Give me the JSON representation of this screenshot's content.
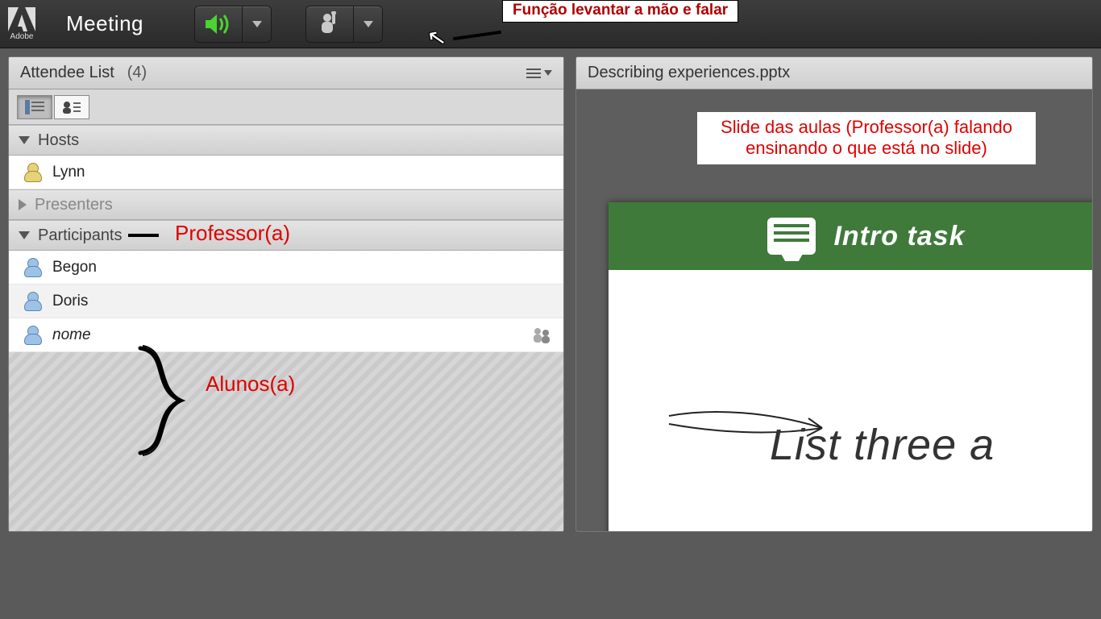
{
  "topbar": {
    "brand": "Adobe",
    "meeting_label": "Meeting",
    "callout_text": "Função levantar a mão e falar"
  },
  "attendees": {
    "panel_title": "Attendee List",
    "count_label": "(4)",
    "sections": {
      "hosts_label": "Hosts",
      "presenters_label": "Presenters",
      "participants_label": "Participants"
    },
    "hosts": [
      "Lynn"
    ],
    "participants": [
      "Begon",
      "Doris",
      "nome"
    ],
    "annotations": {
      "host_role": "Professor(a)",
      "participants_role": "Alunos(a)"
    }
  },
  "share": {
    "file_name": "Describing experiences.pptx",
    "slide_callout": "Slide das aulas (Professor(a) falando ensinando o que está no slide)",
    "slide_banner": "Intro task",
    "slide_body": "List three a"
  }
}
